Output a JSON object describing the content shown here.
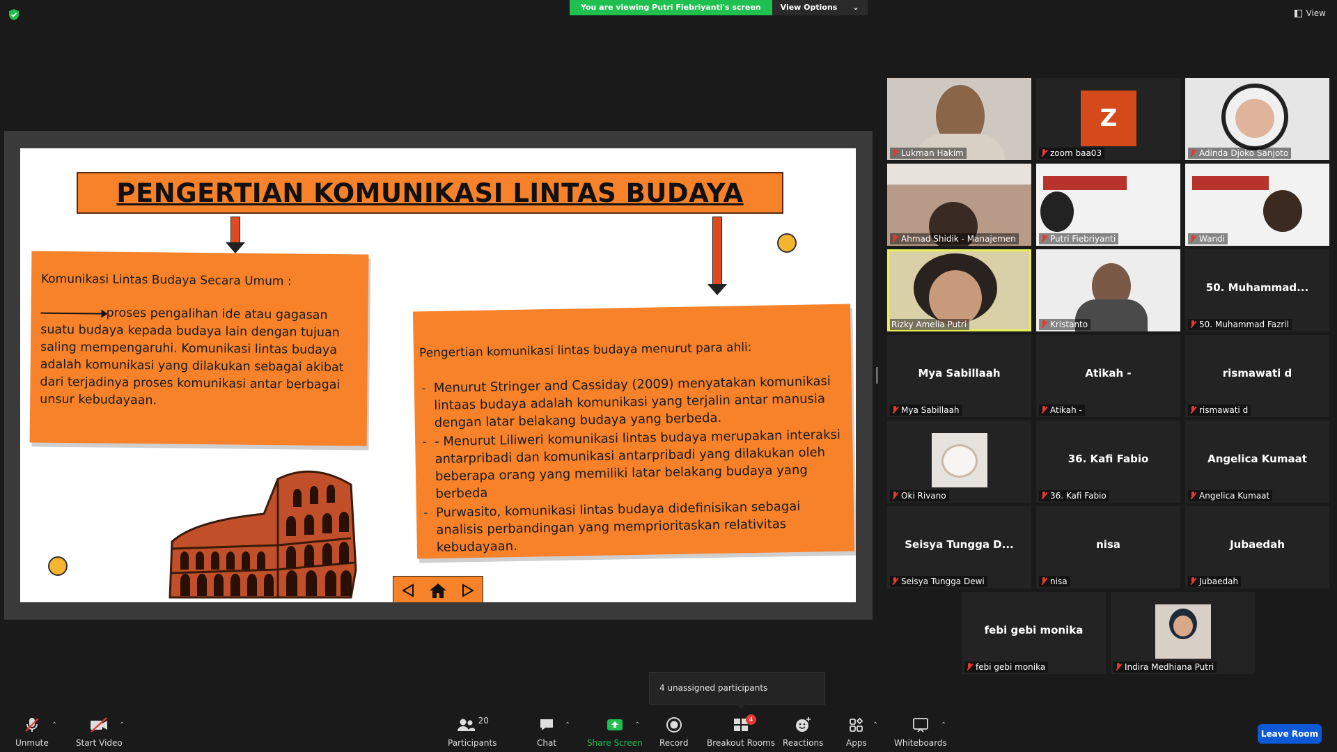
{
  "top_bar": {
    "share_notice": "You are viewing Putri Fiebriyanti's screen",
    "view_options": "View Options",
    "view": "View"
  },
  "slide": {
    "title": "PENGERTIAN KOMUNIKASI LINTAS BUDAYA",
    "left_card": {
      "heading": "Komunikasi Lintas Budaya Secara Umum :",
      "body": "proses pengalihan ide atau gagasan suatu budaya kepada budaya lain dengan tujuan saling mempengaruhi. Komunikasi lintas budaya adalah komunikasi yang dilakukan sebagai akibat dari terjadinya proses komunikasi antar berbagai unsur kebudayaan."
    },
    "right_card": {
      "heading": "Pengertian  komunikasi lintas budaya menurut para ahli:",
      "points": [
        "Menurut Stringer and Cassiday (2009) menyatakan komunikasi lintaas budaya adalah komunikasi yang terjalin antar manusia dengan latar belakang budaya yang berbeda.",
        "- Menurut Liliweri komunikasi lintas budaya merupakan interaksi antarpribadi dan komunikasi antarpribadi yang dilakukan oleh beberapa orang yang memiliki latar belakang budaya yang berbeda",
        "Purwasito, komunikasi lintas budaya didefinisikan sebagai analisis perbandingan yang memprioritaskan relativitas kebudayaan."
      ]
    }
  },
  "participants": [
    {
      "name": "Lukman Hakim",
      "type": "video"
    },
    {
      "name": "zoom baa03",
      "type": "avatar",
      "initial": "Z"
    },
    {
      "name": "Adinda Djoko Sanjoto",
      "type": "video"
    },
    {
      "name": "Ahmad Shidik - Manajemen",
      "type": "video"
    },
    {
      "name": "Putri Fiebriyanti",
      "type": "video"
    },
    {
      "name": "Wandi",
      "type": "video"
    },
    {
      "name": "Rizky Amelia Putri",
      "type": "video",
      "active": true
    },
    {
      "name": "Kristanto",
      "type": "video"
    },
    {
      "name": "50. Muhammad Fazril",
      "type": "name",
      "display": "50.  Muhammad..."
    },
    {
      "name": "Mya Sabillaah",
      "type": "name",
      "display": "Mya Sabillaah"
    },
    {
      "name": "Atikah -",
      "type": "name",
      "display": "Atikah -"
    },
    {
      "name": "rismawati d",
      "type": "name",
      "display": "rismawati d"
    },
    {
      "name": "Oki Rivano",
      "type": "photo"
    },
    {
      "name": "36. Kafi Fabio",
      "type": "name",
      "display": "36. Kafi Fabio"
    },
    {
      "name": "Angelica Kumaat",
      "type": "name",
      "display": "Angelica Kumaat"
    },
    {
      "name": "Seisya Tungga Dewi",
      "type": "name",
      "display": "Seisya Tungga D..."
    },
    {
      "name": "nisa",
      "type": "name",
      "display": "nisa"
    },
    {
      "name": "Jubaedah",
      "type": "name",
      "display": "Jubaedah"
    },
    {
      "name": "febi gebi monika",
      "type": "name",
      "display": "febi gebi monika"
    },
    {
      "name": "Indira Medhiana Putri",
      "type": "photo"
    }
  ],
  "popup": {
    "unassigned": "4 unassigned participants"
  },
  "toolbar": {
    "unmute": "Unmute",
    "start_video": "Start Video",
    "participants": "Participants",
    "participants_count": "20",
    "chat": "Chat",
    "share_screen": "Share Screen",
    "record": "Record",
    "breakout_rooms": "Breakout Rooms",
    "breakout_badge": "4",
    "reactions": "Reactions",
    "apps": "Apps",
    "whiteboards": "Whiteboards",
    "leave_room": "Leave Room"
  },
  "colors": {
    "slide_orange": "#f7822a",
    "share_green": "#1fbf50",
    "leave_blue": "#0e5ad6",
    "muted_red": "#e53935",
    "active_speaker": "#e8ee5a"
  }
}
